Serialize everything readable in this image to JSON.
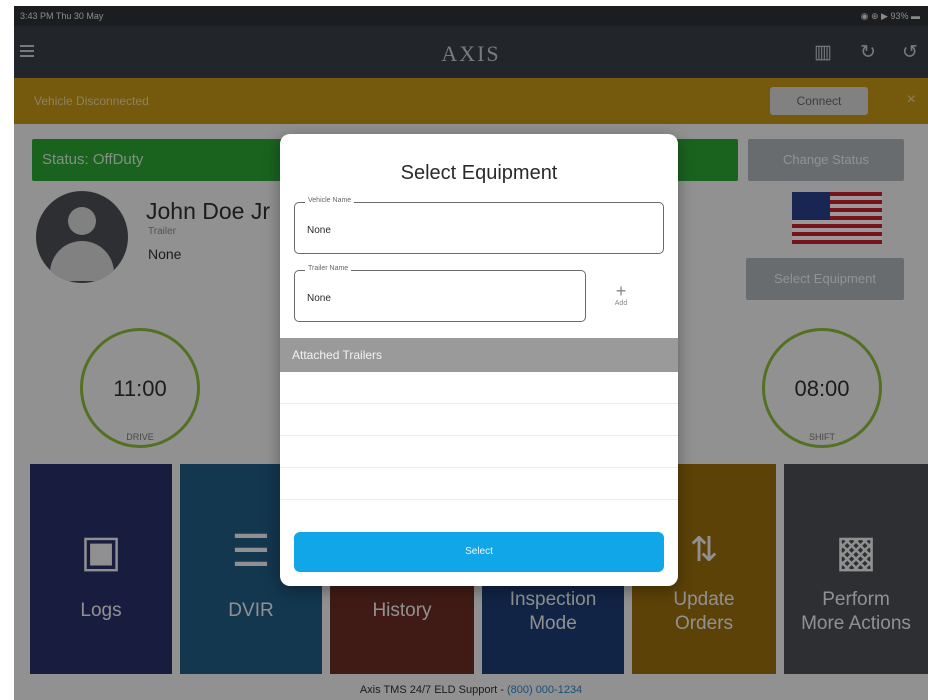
{
  "status_bar": {
    "time": "3:43 PM  Thu 30 May",
    "right": "◉ ⊕ ▶ 93% ▬"
  },
  "app_bar": {
    "title": "AXIS",
    "icons": [
      "menu-icon",
      "driver-icon",
      "refresh-icon",
      "logout-icon"
    ]
  },
  "alert": {
    "message": "Vehicle Disconnected",
    "connect_label": "Connect",
    "close": "×",
    "color": "#c49414"
  },
  "status": {
    "label": "Status: OffDuty",
    "color": "#2aa535"
  },
  "change_status_label": "Change Status",
  "driver": {
    "name": "John Doe Jr",
    "field_label": "Trailer",
    "field_value": "None"
  },
  "select_equipment_button": "Select Equipment",
  "gauges": {
    "drive": {
      "value": "11:00",
      "label": "DRIVE"
    },
    "shift": {
      "value": "08:00",
      "label": "SHIFT"
    }
  },
  "tiles": [
    {
      "label": "Logs",
      "color": "#28306a",
      "icon": "tablet-hand-icon"
    },
    {
      "label": "DVIR",
      "color": "#1e5d84",
      "icon": "checklist-icon"
    },
    {
      "label": "History",
      "color": "#6b2e26",
      "icon": "history-icon"
    },
    {
      "label": "Inspection\nMode",
      "color": "#1d3c74",
      "icon": "inspection-icon"
    },
    {
      "label": "Update\nOrders",
      "color": "#9b6f0d",
      "icon": "swap-arrows-icon"
    },
    {
      "label": "Perform\nMore Actions",
      "color": "#4b4f54",
      "icon": "id-badge-icon"
    }
  ],
  "footer": {
    "text": "Axis TMS 24/7 ELD Support - ",
    "phone": "(800) 000-1234"
  },
  "modal": {
    "title": "Select Equipment",
    "vehicle_label": "Vehicle Name",
    "vehicle_value": "None",
    "trailer_label": "Trailer Name",
    "trailer_value": "None",
    "add_label": "Add",
    "attached_label": "Attached Trailers",
    "select_label": "Select",
    "select_color": "#10a6e8"
  }
}
